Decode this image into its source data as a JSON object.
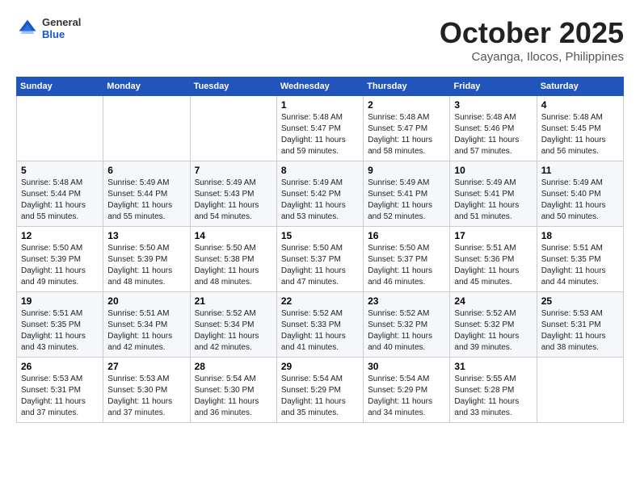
{
  "header": {
    "logo_general": "General",
    "logo_blue": "Blue",
    "month_title": "October 2025",
    "location": "Cayanga, Ilocos, Philippines"
  },
  "calendar": {
    "days_of_week": [
      "Sunday",
      "Monday",
      "Tuesday",
      "Wednesday",
      "Thursday",
      "Friday",
      "Saturday"
    ],
    "weeks": [
      [
        {
          "day": null,
          "info": null
        },
        {
          "day": null,
          "info": null
        },
        {
          "day": null,
          "info": null
        },
        {
          "day": "1",
          "info": "Sunrise: 5:48 AM\nSunset: 5:47 PM\nDaylight: 11 hours\nand 59 minutes."
        },
        {
          "day": "2",
          "info": "Sunrise: 5:48 AM\nSunset: 5:47 PM\nDaylight: 11 hours\nand 58 minutes."
        },
        {
          "day": "3",
          "info": "Sunrise: 5:48 AM\nSunset: 5:46 PM\nDaylight: 11 hours\nand 57 minutes."
        },
        {
          "day": "4",
          "info": "Sunrise: 5:48 AM\nSunset: 5:45 PM\nDaylight: 11 hours\nand 56 minutes."
        }
      ],
      [
        {
          "day": "5",
          "info": "Sunrise: 5:48 AM\nSunset: 5:44 PM\nDaylight: 11 hours\nand 55 minutes."
        },
        {
          "day": "6",
          "info": "Sunrise: 5:49 AM\nSunset: 5:44 PM\nDaylight: 11 hours\nand 55 minutes."
        },
        {
          "day": "7",
          "info": "Sunrise: 5:49 AM\nSunset: 5:43 PM\nDaylight: 11 hours\nand 54 minutes."
        },
        {
          "day": "8",
          "info": "Sunrise: 5:49 AM\nSunset: 5:42 PM\nDaylight: 11 hours\nand 53 minutes."
        },
        {
          "day": "9",
          "info": "Sunrise: 5:49 AM\nSunset: 5:41 PM\nDaylight: 11 hours\nand 52 minutes."
        },
        {
          "day": "10",
          "info": "Sunrise: 5:49 AM\nSunset: 5:41 PM\nDaylight: 11 hours\nand 51 minutes."
        },
        {
          "day": "11",
          "info": "Sunrise: 5:49 AM\nSunset: 5:40 PM\nDaylight: 11 hours\nand 50 minutes."
        }
      ],
      [
        {
          "day": "12",
          "info": "Sunrise: 5:50 AM\nSunset: 5:39 PM\nDaylight: 11 hours\nand 49 minutes."
        },
        {
          "day": "13",
          "info": "Sunrise: 5:50 AM\nSunset: 5:39 PM\nDaylight: 11 hours\nand 48 minutes."
        },
        {
          "day": "14",
          "info": "Sunrise: 5:50 AM\nSunset: 5:38 PM\nDaylight: 11 hours\nand 48 minutes."
        },
        {
          "day": "15",
          "info": "Sunrise: 5:50 AM\nSunset: 5:37 PM\nDaylight: 11 hours\nand 47 minutes."
        },
        {
          "day": "16",
          "info": "Sunrise: 5:50 AM\nSunset: 5:37 PM\nDaylight: 11 hours\nand 46 minutes."
        },
        {
          "day": "17",
          "info": "Sunrise: 5:51 AM\nSunset: 5:36 PM\nDaylight: 11 hours\nand 45 minutes."
        },
        {
          "day": "18",
          "info": "Sunrise: 5:51 AM\nSunset: 5:35 PM\nDaylight: 11 hours\nand 44 minutes."
        }
      ],
      [
        {
          "day": "19",
          "info": "Sunrise: 5:51 AM\nSunset: 5:35 PM\nDaylight: 11 hours\nand 43 minutes."
        },
        {
          "day": "20",
          "info": "Sunrise: 5:51 AM\nSunset: 5:34 PM\nDaylight: 11 hours\nand 42 minutes."
        },
        {
          "day": "21",
          "info": "Sunrise: 5:52 AM\nSunset: 5:34 PM\nDaylight: 11 hours\nand 42 minutes."
        },
        {
          "day": "22",
          "info": "Sunrise: 5:52 AM\nSunset: 5:33 PM\nDaylight: 11 hours\nand 41 minutes."
        },
        {
          "day": "23",
          "info": "Sunrise: 5:52 AM\nSunset: 5:32 PM\nDaylight: 11 hours\nand 40 minutes."
        },
        {
          "day": "24",
          "info": "Sunrise: 5:52 AM\nSunset: 5:32 PM\nDaylight: 11 hours\nand 39 minutes."
        },
        {
          "day": "25",
          "info": "Sunrise: 5:53 AM\nSunset: 5:31 PM\nDaylight: 11 hours\nand 38 minutes."
        }
      ],
      [
        {
          "day": "26",
          "info": "Sunrise: 5:53 AM\nSunset: 5:31 PM\nDaylight: 11 hours\nand 37 minutes."
        },
        {
          "day": "27",
          "info": "Sunrise: 5:53 AM\nSunset: 5:30 PM\nDaylight: 11 hours\nand 37 minutes."
        },
        {
          "day": "28",
          "info": "Sunrise: 5:54 AM\nSunset: 5:30 PM\nDaylight: 11 hours\nand 36 minutes."
        },
        {
          "day": "29",
          "info": "Sunrise: 5:54 AM\nSunset: 5:29 PM\nDaylight: 11 hours\nand 35 minutes."
        },
        {
          "day": "30",
          "info": "Sunrise: 5:54 AM\nSunset: 5:29 PM\nDaylight: 11 hours\nand 34 minutes."
        },
        {
          "day": "31",
          "info": "Sunrise: 5:55 AM\nSunset: 5:28 PM\nDaylight: 11 hours\nand 33 minutes."
        },
        {
          "day": null,
          "info": null
        }
      ]
    ]
  }
}
